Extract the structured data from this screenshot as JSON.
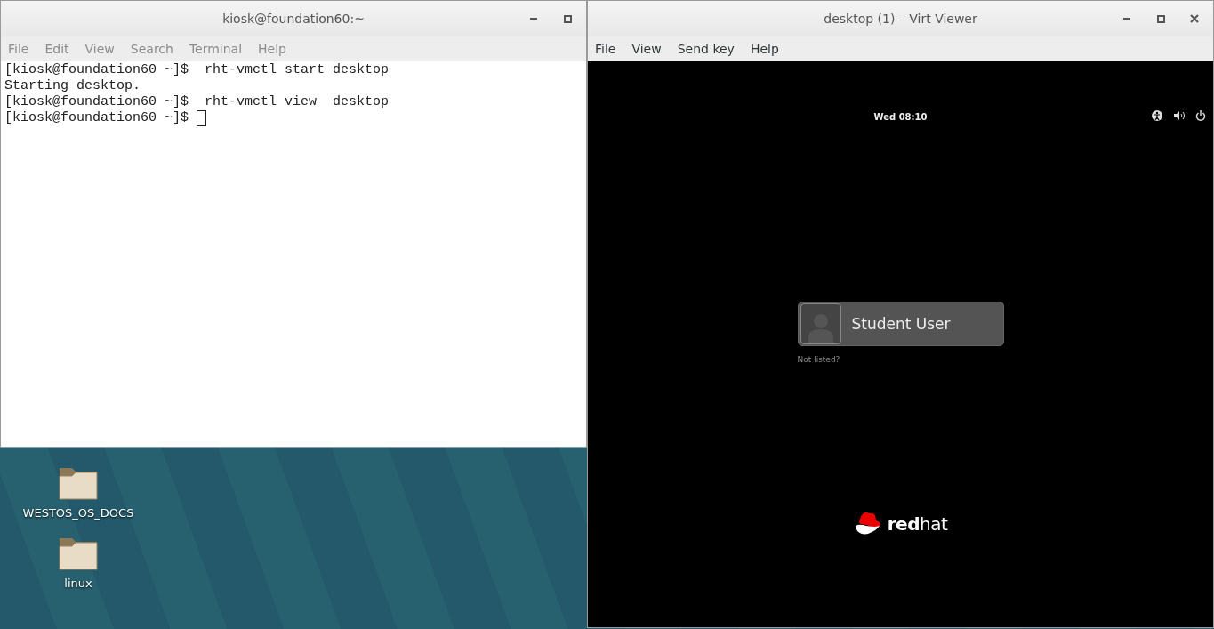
{
  "terminal": {
    "title": "kiosk@foundation60:~",
    "menu": [
      "File",
      "Edit",
      "View",
      "Search",
      "Terminal",
      "Help"
    ],
    "lines": [
      "[kiosk@foundation60 ~]$  rht-vmctl start desktop",
      "Starting desktop.",
      "[kiosk@foundation60 ~]$  rht-vmctl view  desktop",
      "[kiosk@foundation60 ~]$ "
    ]
  },
  "desktop_icons": [
    {
      "label": "WESTOS_OS_DOCS"
    },
    {
      "label": "linux"
    }
  ],
  "viewer": {
    "title": "desktop (1) – Virt Viewer",
    "menu": [
      "File",
      "View",
      "Send key",
      "Help"
    ],
    "guest": {
      "clock": "Wed 08:10",
      "users": [
        {
          "name": "Student User"
        }
      ],
      "not_listed": "Not listed?",
      "logo": "**red**hat"
    }
  }
}
